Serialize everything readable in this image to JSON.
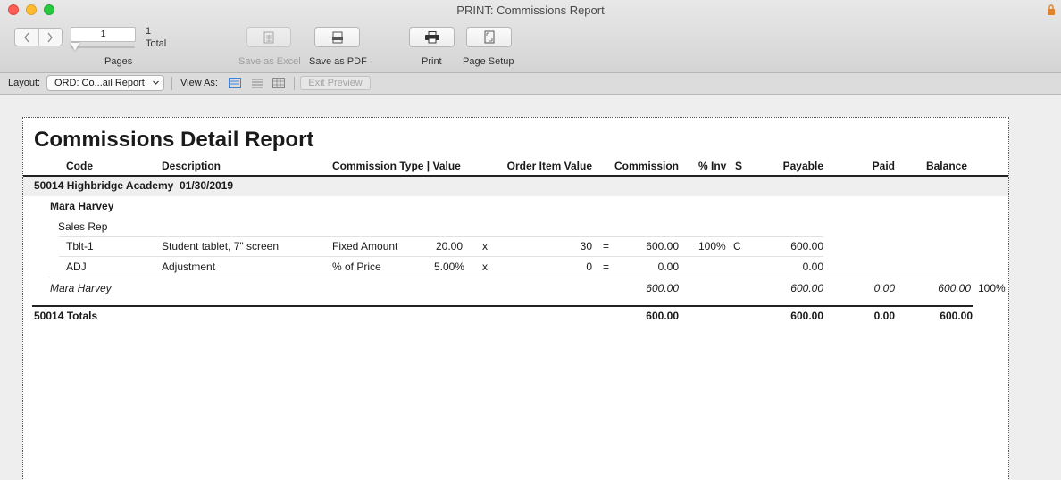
{
  "window": {
    "title": "PRINT: Commissions Report"
  },
  "toolbar": {
    "page_value": "1",
    "total_pages": "1",
    "total_label": "Total",
    "pages_label": "Pages",
    "save_excel_label": "Save as Excel",
    "save_pdf_label": "Save as PDF",
    "print_label": "Print",
    "page_setup_label": "Page Setup"
  },
  "layoutbar": {
    "layout_label": "Layout:",
    "layout_value": "ORD: Co...ail Report",
    "view_as_label": "View As:",
    "exit_preview_label": "Exit Preview"
  },
  "report": {
    "title": "Commissions Detail Report",
    "headers": {
      "code": "Code",
      "description": "Description",
      "commission_type": "Commission Type | Value",
      "order_item_value": "Order Item Value",
      "commission": "Commission",
      "pct_inv": "% Inv",
      "s": "S",
      "payable": "Payable",
      "paid": "Paid",
      "balance": "Balance"
    },
    "group": {
      "order": "50014",
      "name": "Highbridge Academy",
      "date": "01/30/2019"
    },
    "person": "Mara Harvey",
    "role": "Sales Rep",
    "rows": [
      {
        "code": "Tblt-1",
        "description": "Student tablet, 7\" screen",
        "type": "Fixed Amount",
        "value": "20.00",
        "x": "x",
        "order_value": "30",
        "eq": "=",
        "commission": "600.00",
        "pct_inv": "100%",
        "s": "C",
        "payable": "600.00"
      },
      {
        "code": "ADJ",
        "description": "Adjustment",
        "type": "% of Price",
        "value": "5.00%",
        "x": "x",
        "order_value": "0",
        "eq": "=",
        "commission": "0.00",
        "pct_inv": "",
        "s": "",
        "payable": "0.00"
      }
    ],
    "subtotal": {
      "name": "Mara Harvey",
      "commission": "600.00",
      "payable": "600.00",
      "paid": "0.00",
      "balance": "600.00",
      "pct": "100%"
    },
    "totals": {
      "label": "50014 Totals",
      "commission": "600.00",
      "payable": "600.00",
      "paid": "0.00",
      "balance": "600.00"
    }
  },
  "icons": {
    "nav_back": "chevron-left-icon",
    "nav_forward": "chevron-right-icon",
    "excel": "spreadsheet-icon",
    "pdf": "pdf-icon",
    "print": "printer-icon",
    "page_setup": "page-setup-icon"
  }
}
